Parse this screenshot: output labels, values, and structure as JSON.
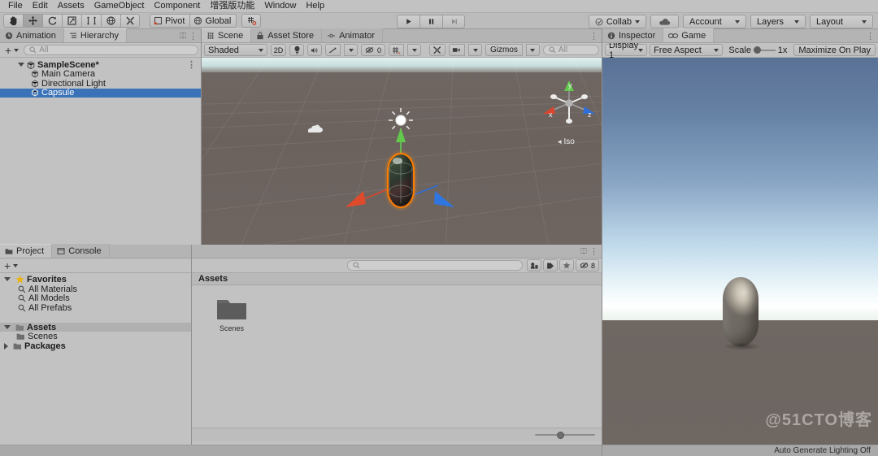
{
  "menubar": {
    "items": [
      "File",
      "Edit",
      "Assets",
      "GameObject",
      "Component",
      "增强版功能",
      "Window",
      "Help"
    ]
  },
  "toolbar": {
    "tools": [
      {
        "name": "hand-tool",
        "label": "Hand"
      },
      {
        "name": "move-tool",
        "label": "Move"
      },
      {
        "name": "rotate-tool",
        "label": "Rotate"
      },
      {
        "name": "scale-tool",
        "label": "Scale"
      },
      {
        "name": "rect-tool",
        "label": "Rect"
      },
      {
        "name": "transform-tool",
        "label": "Transform"
      },
      {
        "name": "custom-tool",
        "label": "Custom"
      }
    ],
    "pivot_label": "Pivot",
    "global_label": "Global",
    "play_label": "Play",
    "pause_label": "Pause",
    "step_label": "Step",
    "collab_label": "Collab",
    "cloud_label": "",
    "account_label": "Account",
    "layers_label": "Layers",
    "layout_label": "Layout"
  },
  "hierarchy": {
    "tabs": [
      {
        "label": "Animation",
        "active": false
      },
      {
        "label": "Hierarchy",
        "active": true
      }
    ],
    "add_label": "+",
    "search_placeholder": "All",
    "scene_name": "SampleScene*",
    "objects": [
      {
        "label": "Main Camera",
        "selected": false
      },
      {
        "label": "Directional Light",
        "selected": false
      },
      {
        "label": "Capsule",
        "selected": true
      }
    ]
  },
  "scene": {
    "tabs": [
      {
        "label": "Scene",
        "active": true
      },
      {
        "label": "Asset Store",
        "active": false
      },
      {
        "label": "Animator",
        "active": false
      }
    ],
    "shading_mode": "Shaded",
    "mode_2d": "2D",
    "audio_value": "0",
    "gizmos_label": "Gizmos",
    "search_placeholder": "All",
    "axis_x": "x",
    "axis_y": "y",
    "axis_z": "z",
    "view_mode": "Iso"
  },
  "project": {
    "tabs": [
      {
        "label": "Project",
        "active": true
      },
      {
        "label": "Console",
        "active": false
      }
    ],
    "add_label": "+",
    "tree": [
      {
        "label": "Favorites",
        "bold": true,
        "indent": 0,
        "icon": "star",
        "expanded": true
      },
      {
        "label": "All Materials",
        "bold": false,
        "indent": 1,
        "icon": "search"
      },
      {
        "label": "All Models",
        "bold": false,
        "indent": 1,
        "icon": "search"
      },
      {
        "label": "All Prefabs",
        "bold": false,
        "indent": 1,
        "icon": "search"
      },
      {
        "label": "Assets",
        "bold": true,
        "indent": 0,
        "icon": "folder",
        "expanded": true,
        "highlight": true
      },
      {
        "label": "Scenes",
        "bold": false,
        "indent": 1,
        "icon": "folder"
      },
      {
        "label": "Packages",
        "bold": true,
        "indent": 0,
        "icon": "folder",
        "expanded": false
      }
    ],
    "search_placeholder": "",
    "badge_count": "8",
    "breadcrumb": "Assets",
    "items": [
      {
        "label": "Scenes",
        "type": "folder"
      }
    ]
  },
  "game": {
    "tabs": [
      {
        "label": "Inspector",
        "active": false
      },
      {
        "label": "Game",
        "active": true
      }
    ],
    "display": "Display 1",
    "aspect": "Free Aspect",
    "scale_label": "Scale",
    "scale_value": "1x",
    "maximize_label": "Maximize On Play",
    "status": "Auto Generate Lighting Off",
    "watermark": "@51CTO博客"
  },
  "colors": {
    "accent_selection": "#3a72b8",
    "axis_x": "#d9462d",
    "axis_y": "#5ec64a",
    "axis_z": "#2f6fd6",
    "outline": "#ff7b00",
    "chrome": "#c2c2c2"
  }
}
